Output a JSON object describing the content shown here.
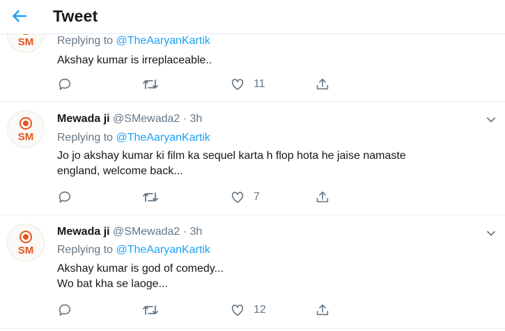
{
  "header": {
    "title": "Tweet",
    "back_icon": "arrow-left-icon",
    "accent": "#1da1f2"
  },
  "tweets": [
    {
      "reply_prefix": "Replying to",
      "reply_mention": "@TheAaryanKartik",
      "avatar_text": "SM",
      "lines": [
        "Akshay kumar is irreplaceable.."
      ],
      "like_count": "11"
    },
    {
      "name": "Mewada ji",
      "handle": "@SMewada2",
      "separator": "·",
      "time": "3h",
      "avatar_text": "SM",
      "reply_prefix": "Replying to",
      "reply_mention": "@TheAaryanKartik",
      "lines": [
        "Jo jo akshay kumar ki film ka sequel karta h flop hota he jaise namaste",
        "england, welcome back..."
      ],
      "like_count": "7"
    },
    {
      "name": "Mewada ji",
      "handle": "@SMewada2",
      "separator": "·",
      "time": "3h",
      "avatar_text": "SM",
      "reply_prefix": "Replying to",
      "reply_mention": "@TheAaryanKartik",
      "lines": [
        "Akshay kumar is god of comedy...",
        "Wo bat kha se laoge..."
      ],
      "like_count": "12"
    }
  ],
  "icons": {
    "reply": "reply-icon",
    "retweet": "retweet-icon",
    "like": "heart-icon",
    "share": "share-icon",
    "more": "chevron-down-icon"
  },
  "colors": {
    "avatar_orange": "#e8541e",
    "text_grey": "#657786",
    "link_blue": "#1da1f2"
  }
}
